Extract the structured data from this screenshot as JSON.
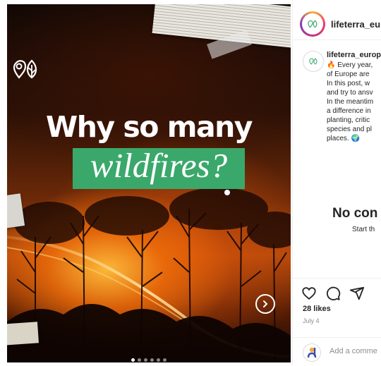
{
  "post": {
    "headline": "Why so many",
    "highlight": "wildfires?",
    "carousel": {
      "count": 6,
      "active_index": 0
    }
  },
  "header": {
    "username": "lifeterra_euro"
  },
  "caption": {
    "username": "lifeterra_europ",
    "lines": [
      "🔥 Every year,",
      "of Europe are",
      "In this post, w",
      "and try to ansv",
      "In the meantim",
      "a difference in",
      "planting, critic",
      "species and pl",
      "places. 🌍"
    ]
  },
  "comments": {
    "empty_title": "No con",
    "empty_subtitle": "Start th"
  },
  "actions": {
    "icons": [
      "heart-icon",
      "comment-icon",
      "share-icon"
    ],
    "likes": "28 likes",
    "date": "July 4"
  },
  "comment_box": {
    "placeholder": "Add a comme"
  },
  "colors": {
    "brand_green": "#3aa86b",
    "text": "#262626",
    "muted": "#8e8e8e"
  }
}
